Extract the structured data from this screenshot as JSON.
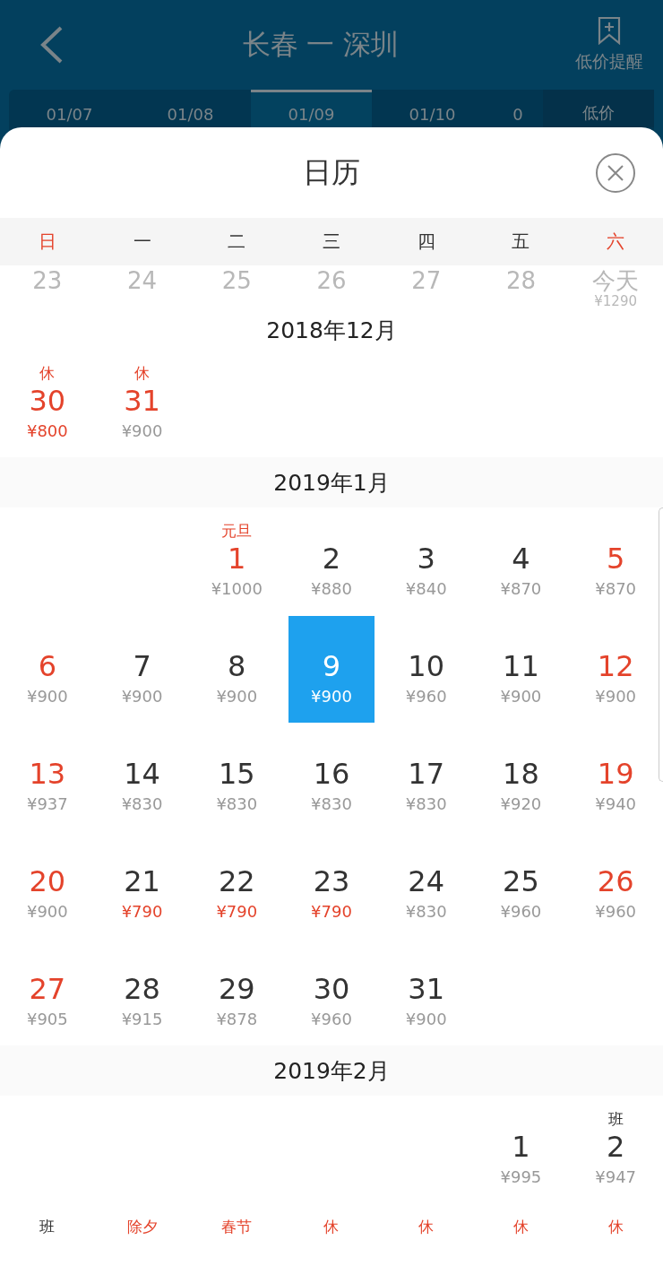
{
  "header": {
    "title": "长春 一 深圳",
    "alert_label": "低价提醒"
  },
  "date_tabs": [
    {
      "label": "01/07",
      "selected": false
    },
    {
      "label": "01/08",
      "selected": false
    },
    {
      "label": "01/09",
      "selected": true
    },
    {
      "label": "01/10",
      "selected": false
    },
    {
      "label": "0",
      "selected": false
    }
  ],
  "low_price_tab": "低价",
  "sheet": {
    "title": "日历"
  },
  "weekdays": [
    {
      "label": "日",
      "weekend": true
    },
    {
      "label": "一",
      "weekend": false
    },
    {
      "label": "二",
      "weekend": false
    },
    {
      "label": "三",
      "weekend": false
    },
    {
      "label": "四",
      "weekend": false
    },
    {
      "label": "五",
      "weekend": false
    },
    {
      "label": "六",
      "weekend": true
    }
  ],
  "faded_row": [
    {
      "day": "23"
    },
    {
      "day": "24"
    },
    {
      "day": "25"
    },
    {
      "day": "26"
    },
    {
      "day": "27"
    },
    {
      "day": "28"
    },
    {
      "day": "今天",
      "price": "¥1290"
    }
  ],
  "months": [
    {
      "title": "2018年12月",
      "days": [
        {
          "day": "30",
          "price": "¥800",
          "red": true,
          "low": true,
          "label": "休",
          "workday": false,
          "selected": false
        },
        {
          "day": "31",
          "price": "¥900",
          "red": true,
          "low": false,
          "label": "休",
          "workday": false,
          "selected": false
        }
      ]
    },
    {
      "title": "2019年1月",
      "days": [
        {
          "kind": "blank"
        },
        {
          "kind": "blank"
        },
        {
          "day": "1",
          "price": "¥1000",
          "red": true,
          "low": false,
          "label": "元旦",
          "workday": false,
          "selected": false
        },
        {
          "day": "2",
          "price": "¥880",
          "red": false,
          "low": false,
          "selected": false
        },
        {
          "day": "3",
          "price": "¥840",
          "red": false,
          "low": false,
          "selected": false
        },
        {
          "day": "4",
          "price": "¥870",
          "red": false,
          "low": false,
          "selected": false
        },
        {
          "day": "5",
          "price": "¥870",
          "red": true,
          "low": false,
          "selected": false
        },
        {
          "day": "6",
          "price": "¥900",
          "red": true,
          "low": false,
          "selected": false
        },
        {
          "day": "7",
          "price": "¥900",
          "red": false,
          "low": false,
          "selected": false
        },
        {
          "day": "8",
          "price": "¥900",
          "red": false,
          "low": false,
          "selected": false
        },
        {
          "day": "9",
          "price": "¥900",
          "red": false,
          "low": false,
          "selected": true
        },
        {
          "day": "10",
          "price": "¥960",
          "red": false,
          "low": false,
          "selected": false
        },
        {
          "day": "11",
          "price": "¥900",
          "red": false,
          "low": false,
          "selected": false
        },
        {
          "day": "12",
          "price": "¥900",
          "red": true,
          "low": false,
          "selected": false
        },
        {
          "day": "13",
          "price": "¥937",
          "red": true,
          "low": false,
          "selected": false
        },
        {
          "day": "14",
          "price": "¥830",
          "red": false,
          "low": false,
          "selected": false
        },
        {
          "day": "15",
          "price": "¥830",
          "red": false,
          "low": false,
          "selected": false
        },
        {
          "day": "16",
          "price": "¥830",
          "red": false,
          "low": false,
          "selected": false
        },
        {
          "day": "17",
          "price": "¥830",
          "red": false,
          "low": false,
          "selected": false
        },
        {
          "day": "18",
          "price": "¥920",
          "red": false,
          "low": false,
          "selected": false
        },
        {
          "day": "19",
          "price": "¥940",
          "red": true,
          "low": false,
          "selected": false
        },
        {
          "day": "20",
          "price": "¥900",
          "red": true,
          "low": false,
          "selected": false
        },
        {
          "day": "21",
          "price": "¥790",
          "red": false,
          "low": true,
          "selected": false
        },
        {
          "day": "22",
          "price": "¥790",
          "red": false,
          "low": true,
          "selected": false
        },
        {
          "day": "23",
          "price": "¥790",
          "red": false,
          "low": true,
          "selected": false
        },
        {
          "day": "24",
          "price": "¥830",
          "red": false,
          "low": false,
          "selected": false
        },
        {
          "day": "25",
          "price": "¥960",
          "red": false,
          "low": false,
          "selected": false
        },
        {
          "day": "26",
          "price": "¥960",
          "red": true,
          "low": false,
          "selected": false
        },
        {
          "day": "27",
          "price": "¥905",
          "red": true,
          "low": false,
          "selected": false
        },
        {
          "day": "28",
          "price": "¥915",
          "red": false,
          "low": false,
          "selected": false
        },
        {
          "day": "29",
          "price": "¥878",
          "red": false,
          "low": false,
          "selected": false
        },
        {
          "day": "30",
          "price": "¥960",
          "red": false,
          "low": false,
          "selected": false
        },
        {
          "day": "31",
          "price": "¥900",
          "red": false,
          "low": false,
          "selected": false
        }
      ]
    },
    {
      "title": "2019年2月",
      "days": [
        {
          "kind": "blank"
        },
        {
          "kind": "blank"
        },
        {
          "kind": "blank"
        },
        {
          "kind": "blank"
        },
        {
          "kind": "blank"
        },
        {
          "day": "1",
          "price": "¥995",
          "red": false,
          "low": false,
          "selected": false
        },
        {
          "day": "2",
          "price": "¥947",
          "red": false,
          "low": false,
          "label": "班",
          "workday": true,
          "selected": false
        },
        {
          "label": "班",
          "workday": true,
          "selected": false
        },
        {
          "label": "除夕",
          "workday": false,
          "selected": false
        },
        {
          "label": "春节",
          "workday": false,
          "selected": false
        },
        {
          "label": "休",
          "workday": false,
          "selected": false
        },
        {
          "label": "休",
          "workday": false,
          "selected": false
        },
        {
          "label": "休",
          "workday": false,
          "selected": false
        },
        {
          "label": "休",
          "workday": false,
          "selected": false
        }
      ]
    }
  ]
}
